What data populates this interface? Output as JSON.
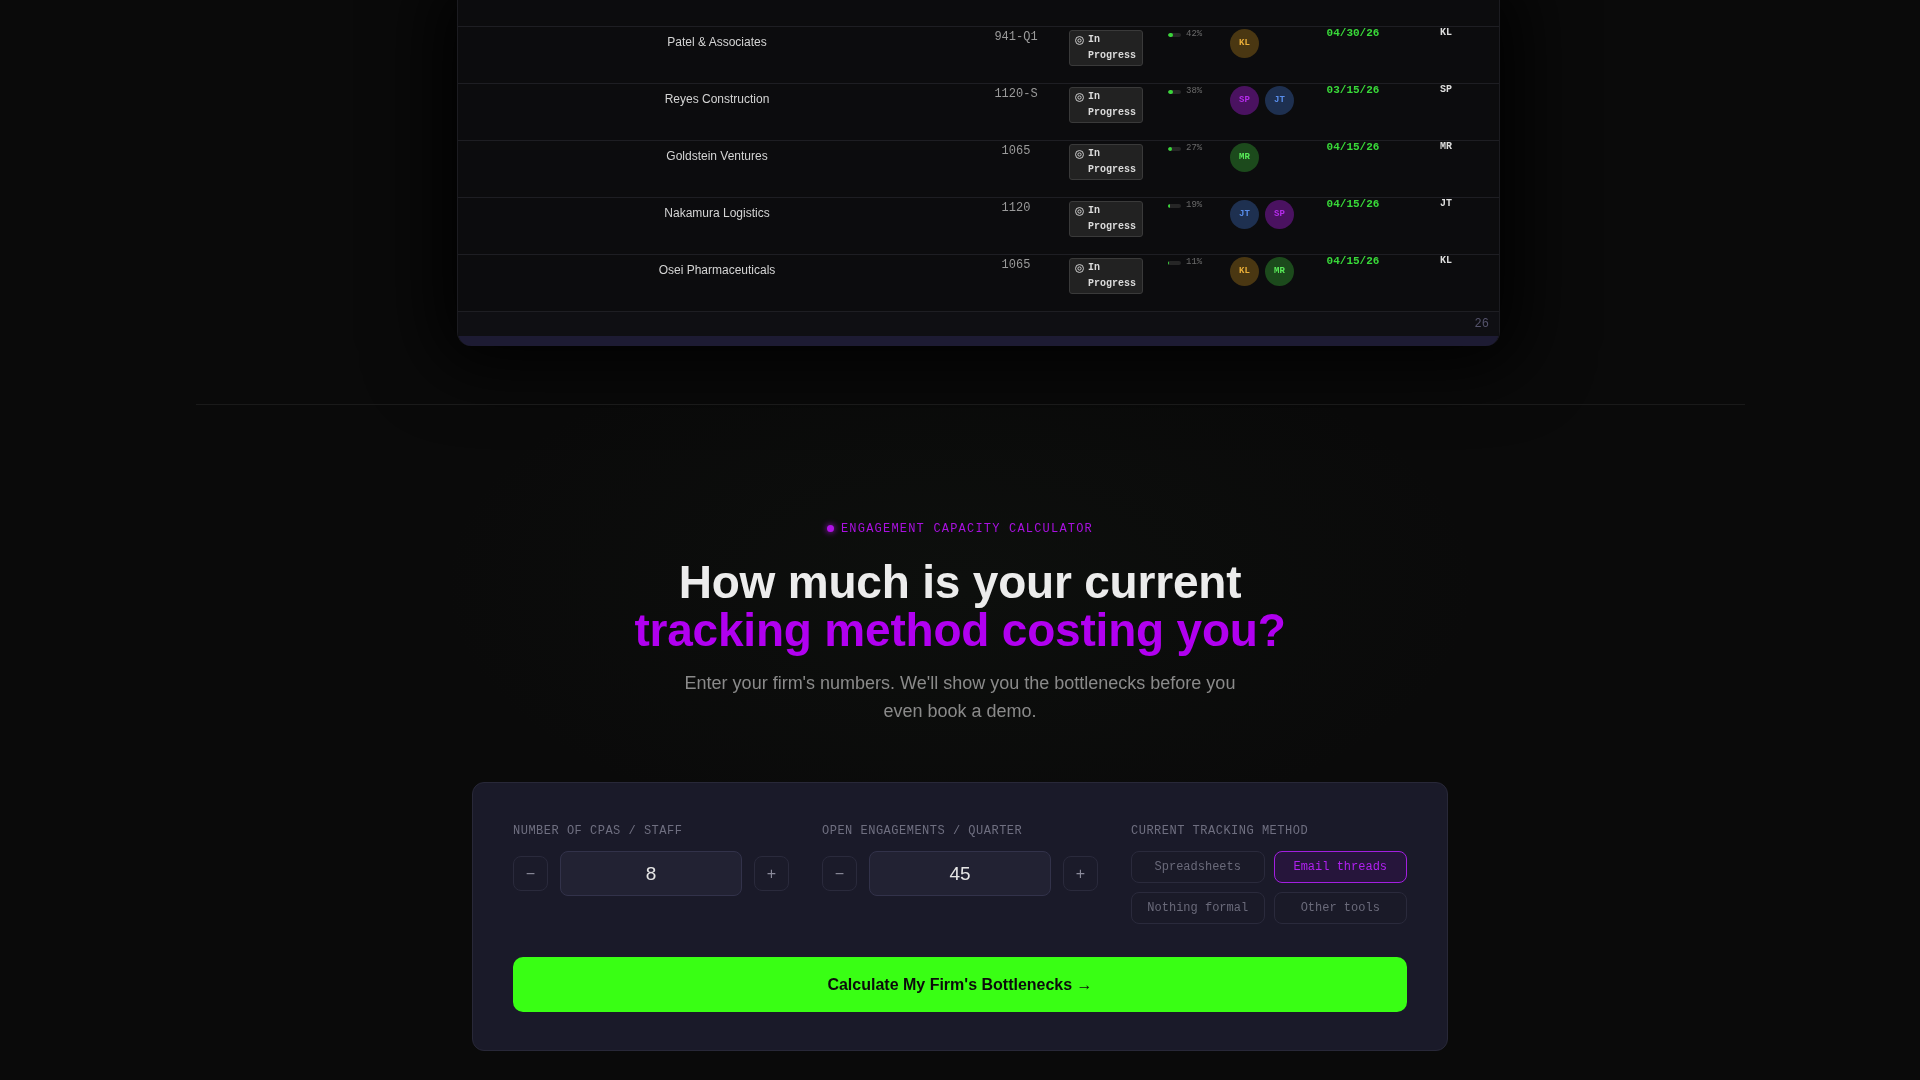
{
  "table": {
    "rows": [
      {
        "client": "Patel & Associates",
        "code": "941-Q1",
        "status": "In Progress",
        "level": 0.42,
        "percent": "42%",
        "assignees": [
          {
            "initials": "KL",
            "color": "#4a3712"
          }
        ],
        "due": "04/30/26",
        "owner": "KL"
      },
      {
        "client": "Reyes Construction",
        "code": "1120-S",
        "status": "In Progress",
        "level": 0.38,
        "percent": "38%",
        "assignees": [
          {
            "initials": "SP",
            "color": "#4a1260"
          },
          {
            "initials": "JT",
            "color": "#1e3050"
          }
        ],
        "due": "03/15/26",
        "owner": "SP"
      },
      {
        "client": "Goldstein Ventures",
        "code": "1065",
        "status": "In Progress",
        "level": 0.27,
        "percent": "27%",
        "assignees": [
          {
            "initials": "MR",
            "color": "#1c4a1c"
          }
        ],
        "due": "04/15/26",
        "owner": "MR"
      },
      {
        "client": "Nakamura Logistics",
        "code": "1120",
        "status": "In Progress",
        "level": 0.19,
        "percent": "19%",
        "assignees": [
          {
            "initials": "JT",
            "color": "#1e3050"
          },
          {
            "initials": "SP",
            "color": "#4a1260"
          }
        ],
        "due": "04/15/26",
        "owner": "JT"
      },
      {
        "client": "Osei Pharmaceuticals",
        "code": "1065",
        "status": "In Progress",
        "level": 0.11,
        "percent": "11%",
        "assignees": [
          {
            "initials": "KL",
            "color": "#4a3712"
          },
          {
            "initials": "MR",
            "color": "#1c4a1c"
          }
        ],
        "due": "04/15/26",
        "owner": "KL"
      }
    ],
    "footer_text": "26"
  },
  "calculator": {
    "eyebrow": "ENGAGEMENT CAPACITY CALCULATOR",
    "heading": "How much is your current",
    "heading_accent": "tracking method costing you?",
    "subtitle": "Enter your firm's numbers. We'll show you the bottlenecks before you even book a demo.",
    "fields": [
      {
        "label": "NUMBER OF CPAS / STAFF",
        "decrement": "−",
        "value": "8",
        "increment": "+"
      },
      {
        "label": "OPEN ENGAGEMENTS / QUARTER",
        "decrement": "−",
        "value": "45",
        "increment": "+"
      }
    ],
    "tracking": {
      "label": "CURRENT TRACKING METHOD",
      "options": [
        {
          "label": "Spreadsheets",
          "selected": false
        },
        {
          "label": "Email threads",
          "selected": true
        },
        {
          "label": "Nothing formal",
          "selected": false
        },
        {
          "label": "Other tools",
          "selected": false
        }
      ]
    },
    "submit": "Calculate My Firm's Bottlenecks →"
  }
}
